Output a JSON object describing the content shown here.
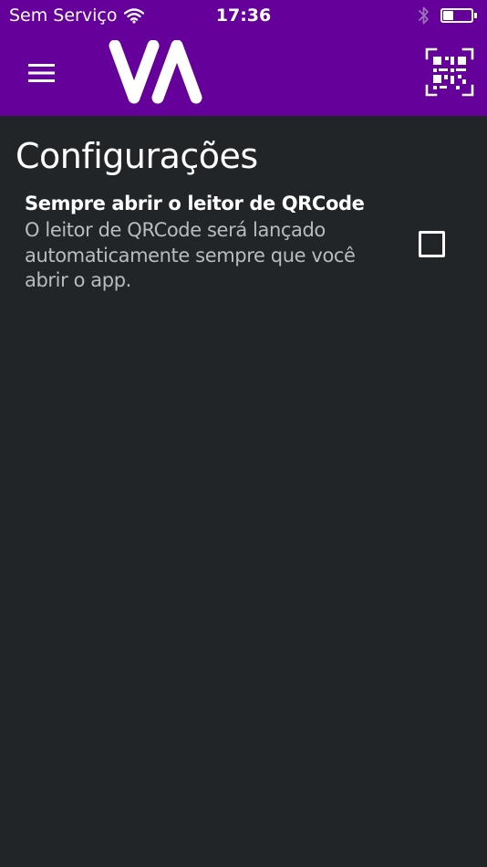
{
  "statusbar": {
    "carrier": "Sem Serviço",
    "time": "17:36",
    "battery_level": 0.35
  },
  "header": {
    "logo_text": "VA",
    "background_color": "#65009a",
    "menu_icon": "hamburger-menu-icon",
    "qr_icon": "qr-code-scan-icon"
  },
  "page": {
    "title": "Configurações"
  },
  "settings": [
    {
      "title": "Sempre abrir o leitor de QRCode",
      "description": "O leitor de QRCode será lançado automaticamente sempre que você abrir o app.",
      "checked": false
    }
  ]
}
